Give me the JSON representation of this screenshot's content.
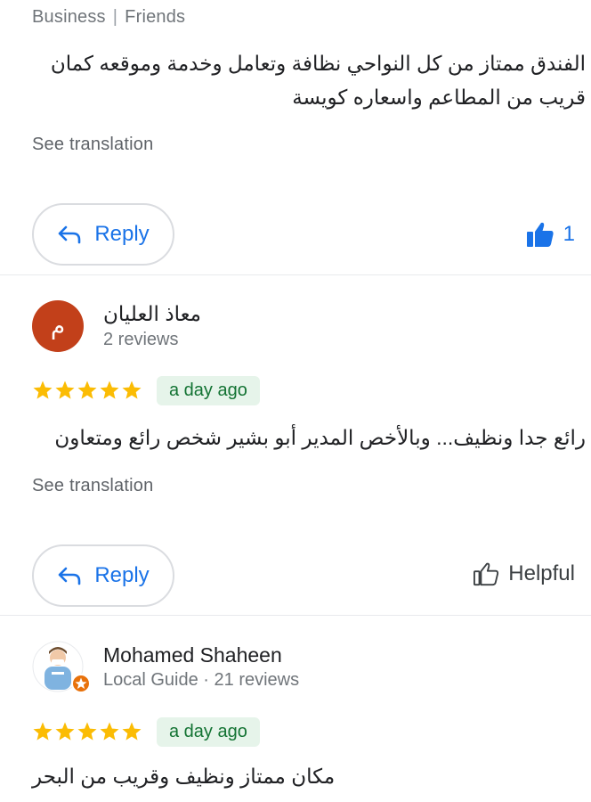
{
  "top_review": {
    "tags": [
      "Business",
      "Friends"
    ],
    "text": "الفندق ممتاز من كل النواحي نظافة وتعامل وخدمة وموقعه كمان قريب من المطاعم واسعاره كويسة",
    "see_translation": "See translation",
    "reply_label": "Reply",
    "likes_count": "1"
  },
  "review_2": {
    "avatar_letter": "م",
    "avatar_color": "#c2401a",
    "author": "معاذ العليان",
    "meta": "2 reviews",
    "rating": 5,
    "time": "a day ago",
    "text": "رائع جدا ونظيف... وبالأخص المدير أبو بشير شخص رائع ومتعاون",
    "see_translation": "See translation",
    "reply_label": "Reply",
    "helpful_label": "Helpful"
  },
  "review_3": {
    "author": "Mohamed Shaheen",
    "meta": "Local Guide · 21 reviews",
    "rating": 5,
    "time": "a day ago",
    "text": "مكان ممتاز ونظيف وقريب من البحر"
  },
  "colors": {
    "accent": "#1a73e8",
    "star": "#fbbc04",
    "badge_bg": "#e6f4ea",
    "badge_text": "#137333",
    "local_guide": "#e8710a"
  }
}
